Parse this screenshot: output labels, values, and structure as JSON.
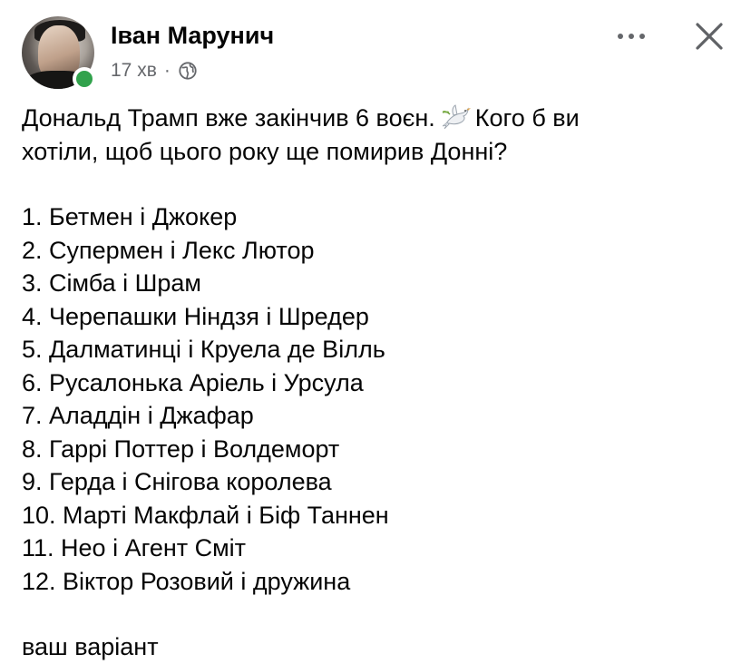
{
  "post": {
    "author": "Іван Марунич",
    "time": "17 хв",
    "separator": "·",
    "privacy_icon": "globe-icon",
    "more_icon": "more-horizontal-icon",
    "close_icon": "close-icon",
    "online_status_color": "#31a24c",
    "text": {
      "line1_before_emoji": "Дональд Трамп вже закінчив 6 воєн.",
      "emoji": "dove-icon",
      "line1_after_emoji": "Кого б ви",
      "line2": "хотіли, щоб цього року ще помирив Донні?",
      "list": [
        "1. Бетмен і Джокер",
        "2. Супермен і Лекс Лютор",
        "3. Сімба і Шрам",
        "4. Черепашки Ніндзя і Шредер",
        "5. Далматинці і Круела де Вілль",
        "6. Русалонька Аріель і Урсула",
        "7. Аладдін і Джафар",
        "8. Гаррі Поттер і Волдеморт",
        "9. Герда і Снігова королева",
        "10. Марті Макфлай і Біф Таннен",
        "11. Нео і Агент Сміт",
        "12. Віктор Розовий і дружина"
      ],
      "outro": "ваш варіант"
    }
  }
}
